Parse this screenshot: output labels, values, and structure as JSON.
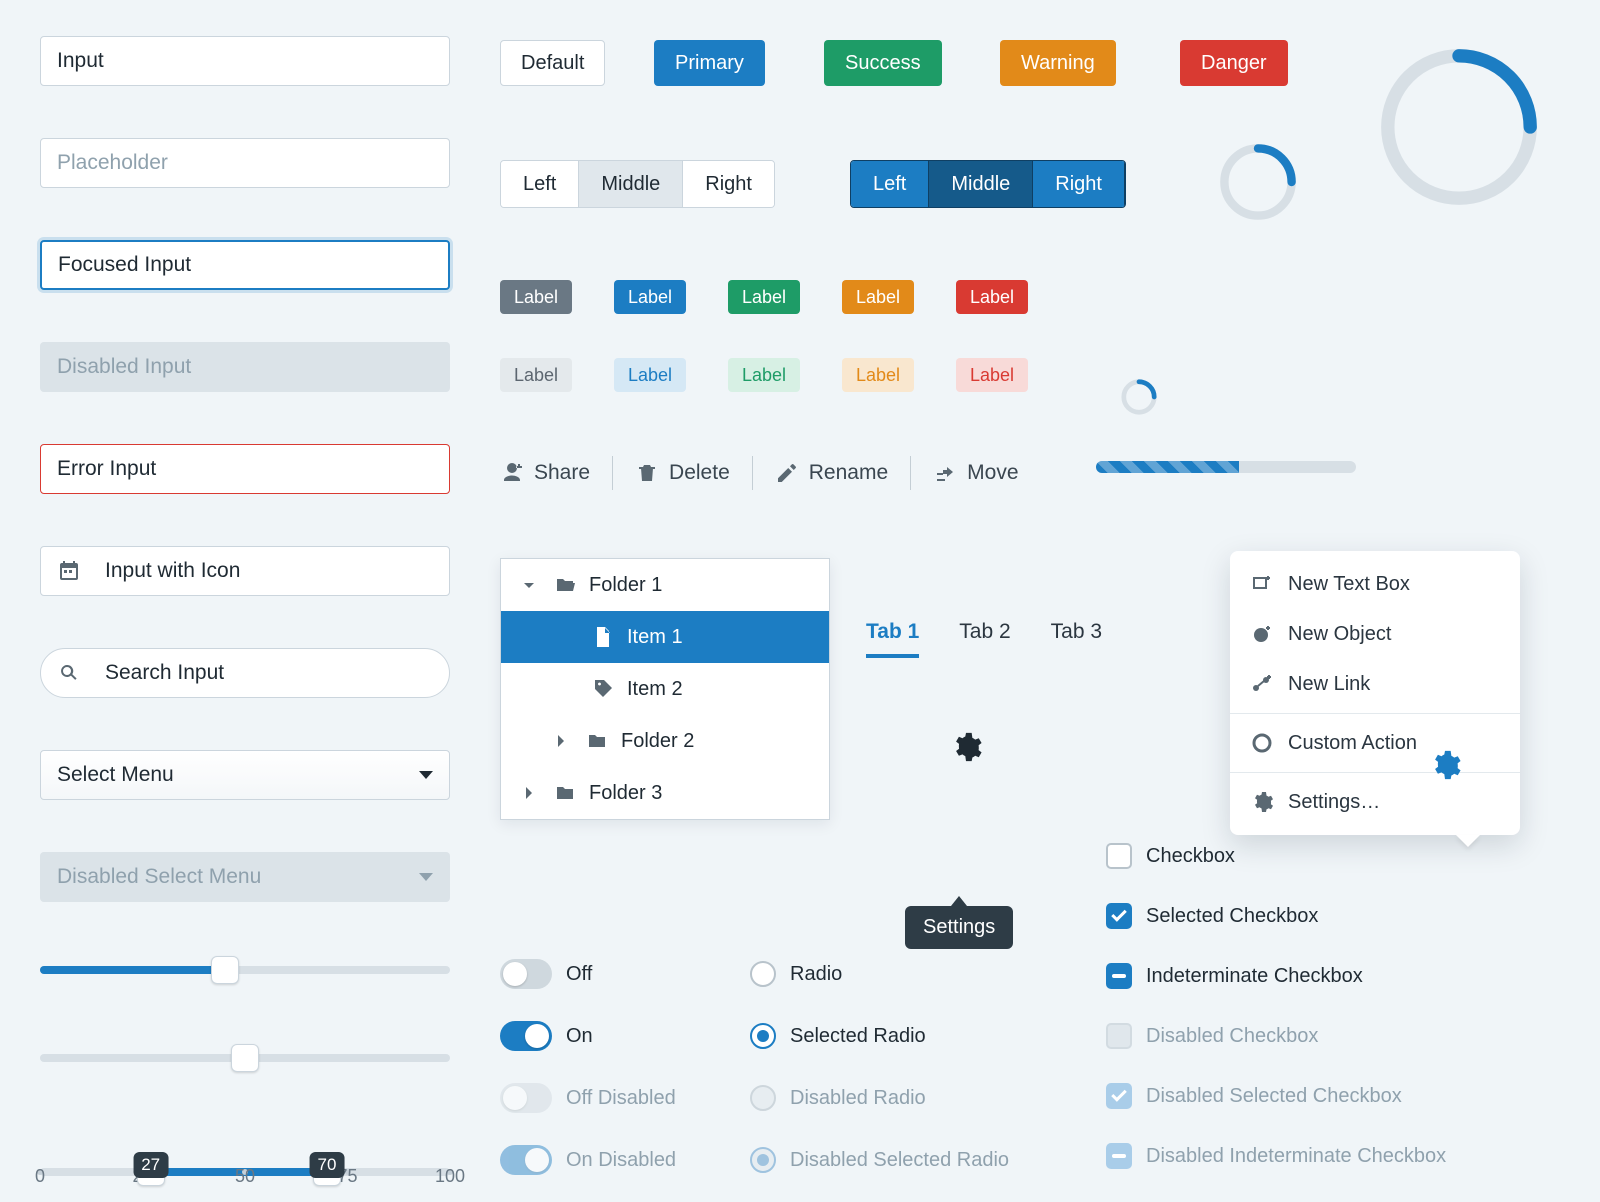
{
  "inputs": {
    "value": "Input",
    "placeholder": "Placeholder",
    "focused": "Focused Input",
    "disabled": "Disabled Input",
    "error": "Error Input",
    "with_icon": "Input with Icon",
    "search": "Search Input"
  },
  "selects": {
    "normal": "Select Menu",
    "disabled": "Disabled Select Menu"
  },
  "sliders": {
    "single_pct": 45,
    "double_pct": 50,
    "range": {
      "min": 0,
      "max": 100,
      "low": 27,
      "high": 70,
      "ticks": [
        0,
        25,
        50,
        75,
        100
      ]
    }
  },
  "buttons": {
    "default": "Default",
    "primary": "Primary",
    "success": "Success",
    "warning": "Warning",
    "danger": "Danger"
  },
  "btngroup_light": {
    "left": "Left",
    "middle": "Middle",
    "right": "Right",
    "active": "middle"
  },
  "btngroup_dark": {
    "left": "Left",
    "middle": "Middle",
    "right": "Right",
    "active": "middle"
  },
  "tag_label": "Label",
  "toolbar": {
    "share": "Share",
    "delete": "Delete",
    "rename": "Rename",
    "move": "Move"
  },
  "tree": {
    "folder1": "Folder 1",
    "item1": "Item 1",
    "item2": "Item 2",
    "folder2": "Folder 2",
    "folder3": "Folder 3"
  },
  "tabs": {
    "t1": "Tab 1",
    "t2": "Tab 2",
    "t3": "Tab 3",
    "active": "t1"
  },
  "tooltip": "Settings",
  "menu": {
    "new_text": "New Text Box",
    "new_object": "New Object",
    "new_link": "New Link",
    "custom": "Custom Action",
    "settings": "Settings…"
  },
  "progress_pct": 55,
  "spinner_small_pct": 30,
  "spinner_med_pct": 35,
  "spinner_large_pct": 30,
  "switches": {
    "off": "Off",
    "on": "On",
    "off_disabled": "Off Disabled",
    "on_disabled": "On Disabled"
  },
  "radios": {
    "radio": "Radio",
    "selected": "Selected Radio",
    "disabled": "Disabled Radio",
    "disabled_selected": "Disabled Selected Radio"
  },
  "checkboxes": {
    "cb": "Checkbox",
    "sel": "Selected Checkbox",
    "ind": "Indeterminate Checkbox",
    "dis": "Disabled Checkbox",
    "dis_sel": "Disabled Selected Checkbox",
    "dis_ind": "Disabled Indeterminate Checkbox"
  },
  "colors": {
    "primary": "#1c7dc3",
    "success": "#1e9c67",
    "warning": "#e28a19",
    "danger": "#d93a32",
    "grey": "#6a7884"
  }
}
